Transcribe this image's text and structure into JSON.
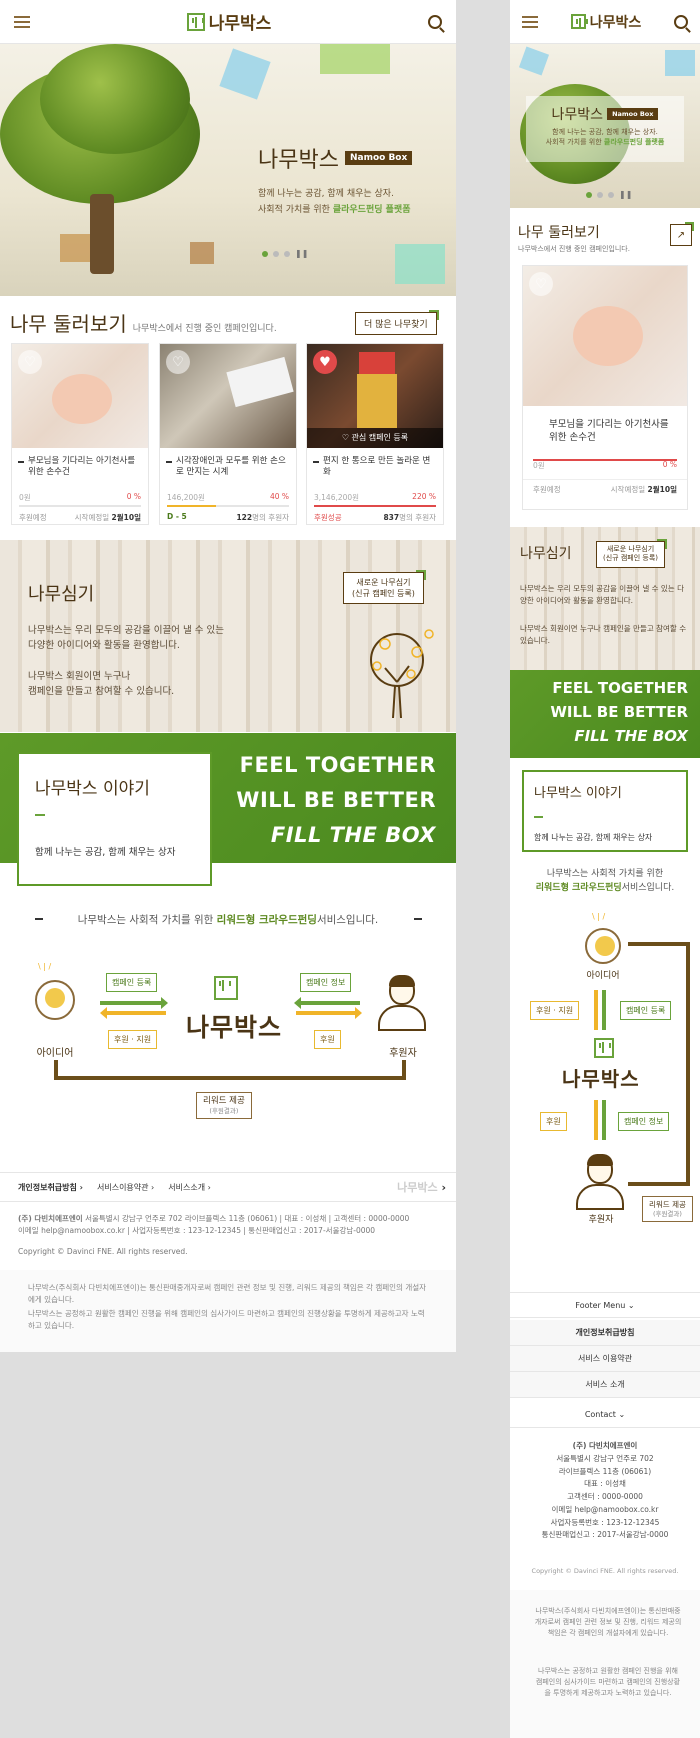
{
  "brand": {
    "name": "나무박스"
  },
  "hero": {
    "title": "나무박스",
    "badge": "Namoo Box",
    "line1": "함께 나누는 공감, 함께 채우는 상자.",
    "line2_pre": "사회적 가치를 위한 ",
    "line2_em": "클라우드펀딩 플랫폼"
  },
  "browse": {
    "title": "나무 둘러보기",
    "subtitle": "나무박스에서 진행 중인 캠페인입니다.",
    "more_label": "더 많은 나무찾기"
  },
  "cards": [
    {
      "title": "부모님을 기다리는 아기천사를 위한 손수건",
      "amount": "0원",
      "percent": "0 %",
      "progress": 0,
      "bar_color": "#e04a4a",
      "status": "후원예정",
      "footer_label": "시작예정일",
      "footer_value": "2월10일",
      "liked": false
    },
    {
      "title": "시각장애인과 모두를 위한 손으로 만지는 시계",
      "amount": "146,200원",
      "percent": "40 %",
      "progress": 40,
      "bar_color": "#f0b429",
      "status": "D - 5",
      "footer_label": "명의 후원자",
      "footer_value": "122",
      "liked": false
    },
    {
      "title": "편지 한 통으로 만든 놀라운 변화",
      "amount": "3,146,200원",
      "percent": "220 %",
      "progress": 100,
      "bar_color": "#e04a4a",
      "status": "후원성공",
      "footer_label": "명의 후원자",
      "footer_value": "837",
      "liked": true,
      "overlay": "관심 캠페인 등록"
    }
  ],
  "planting": {
    "title": "나무심기",
    "button_line1": "새로운 나무심기",
    "button_line2": "(신규 캠페인 등록)",
    "p1a": "나무박스는 우리 모두의 공감을 이끌어 낼 수 있는",
    "p1b": "다양한 아이디어와 활동을 환영합니다.",
    "p2a": "나무박스 회원이면 누구나",
    "p2b": "캠페인을 만들고 참여할 수 있습니다."
  },
  "story": {
    "title": "나무박스 이야기",
    "subtitle": "함께 나누는 공감, 함께 채우는 상자",
    "slogan1": "FEEL TOGETHER",
    "slogan2": "WILL BE BETTER",
    "slogan3": "FILL THE BOX"
  },
  "intro": {
    "pre": "나무박스는 사회적 가치를 위한 ",
    "em": "리워드형 크라우드펀딩",
    "post": "서비스입니다."
  },
  "diagram": {
    "idea": "아이디어",
    "sponsor": "후원자",
    "campaign_register": "캠페인 등록",
    "support": "후원 · 지원",
    "campaign_info": "캠페인 정보",
    "sponsor_tag": "후원",
    "reward": "리워드 제공",
    "reward_sub": "(후원결과)"
  },
  "footer": {
    "links": [
      "개인정보취급방침",
      "서비스이용약관",
      "서비스소개"
    ],
    "company": "(주) 다빈치에프엔이",
    "info1": "서울특별시 강남구 언주로 702 라이브플렉스 11층 (06061)  |  대표 : 이성채  |  고객센터 : 0000-0000",
    "info2": "이메일 help@namoobox.co.kr  |  사업자등록번호 : 123-12-12345  |  통신판매업신고 : 2017-서울강남-0000",
    "copyright": "Copyright © Davinci FNE. All rights reserved.",
    "notice1": "나무박스(주식회사 다빈치에프엔이)는 통신판매중개자로써 캠페인 관련 정보 및 진행, 리워드 제공의 책임은 각 캠페인의 개설자에게 있습니다.",
    "notice2": "나무박스는 공정하고 원활한 캠페인 진행을 위해 캠페인의 심사가이드 마련하고 캠페인의 진행상황을 투명하게 제공하고자 노력하고 있습니다."
  },
  "mobile": {
    "browse_title": "나무 둘러보기",
    "browse_sub": "나무박스에서 진행 중인 캠페인입니다.",
    "footer_menu": "Footer Menu",
    "menu_items": [
      "개인정보취급방침",
      "서비스 이용약관",
      "서비스 소개"
    ],
    "contact": "Contact",
    "addr": [
      "(주) 다빈치에프엔이",
      "서울특별시 강남구 언주로 702",
      "라이브플렉스 11층 (06061)",
      "대표 : 이성채",
      "고객센터 : 0000-0000",
      "이메일 help@namoobox.co.kr",
      "사업자등록번호 : 123-12-12345",
      "통신판매업신고 : 2017-서울강남-0000"
    ],
    "diagram_sponsor_support": "후원 · 지원",
    "diagram_sponsor": "후원"
  }
}
